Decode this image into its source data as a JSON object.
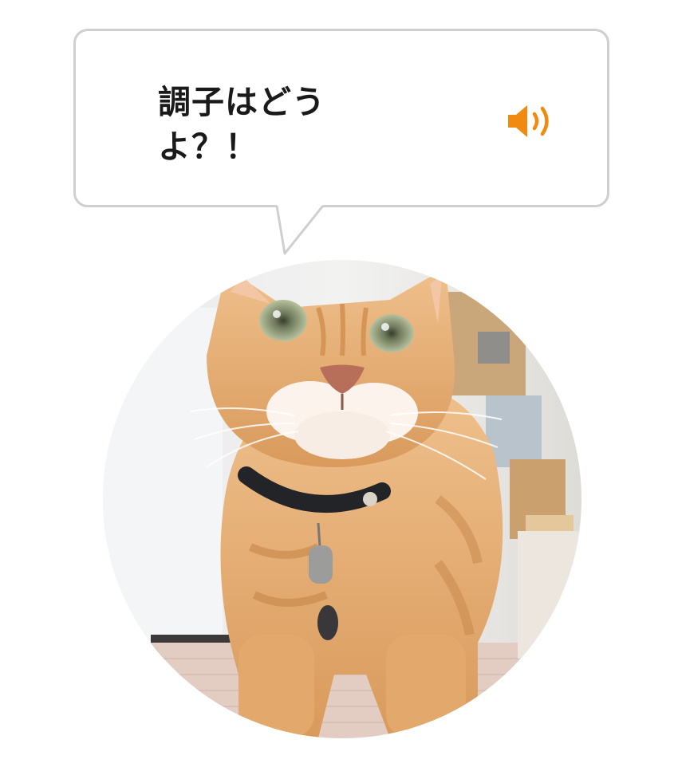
{
  "bubble": {
    "text": "調子はどう\nよ？！"
  },
  "icons": {
    "speaker": "speaker-icon"
  },
  "colors": {
    "accent": "#f08a10",
    "bubble_border": "#cfcfd3",
    "text": "#1a1a1a",
    "cat_fur": "#e8a86a"
  }
}
